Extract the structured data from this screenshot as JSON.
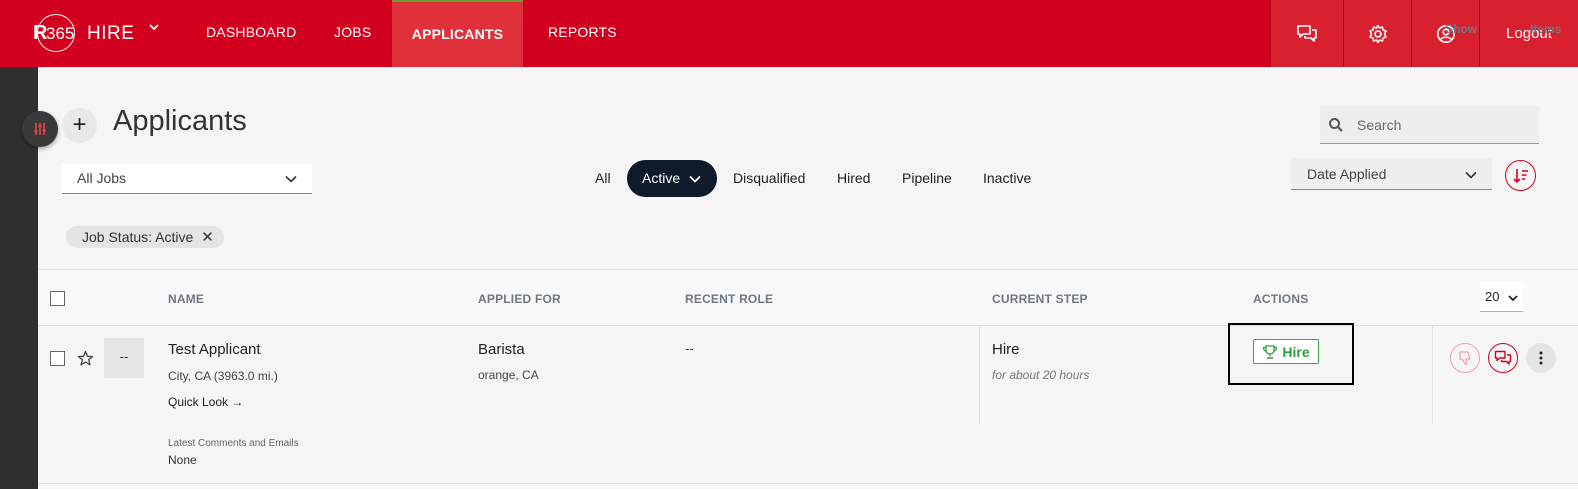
{
  "brand": {
    "logo_r": "R",
    "logo_365": "365",
    "logo_hire": "HIRE",
    "accent": "#d2001e"
  },
  "nav": {
    "items": [
      {
        "label": "DASHBOARD"
      },
      {
        "label": "JOBS"
      },
      {
        "label": "APPLICANTS"
      },
      {
        "label": "REPORTS"
      }
    ],
    "active": "APPLICANTS",
    "logout": "Logout",
    "icons": [
      "chat-icon",
      "gear-icon",
      "user-icon"
    ]
  },
  "page": {
    "title": "Applicants",
    "add_label": "+",
    "search_placeholder": "Search"
  },
  "filters": {
    "jobs_select": "All Jobs",
    "tabs": [
      "All",
      "Active",
      "Disqualified",
      "Hired",
      "Pipeline",
      "Inactive"
    ],
    "active_tab": "Active",
    "sort_by": "Date Applied",
    "chip": "Job Status: Active",
    "chip_close": "✕"
  },
  "table": {
    "headers": [
      "NAME",
      "APPLIED FOR",
      "RECENT ROLE",
      "CURRENT STEP",
      "ACTIONS"
    ],
    "show_label": "Show",
    "page_size": "20",
    "items_label": "Items",
    "rows": [
      {
        "avatar": "--",
        "name": "Test Applicant",
        "location": "City, CA (3963.0 mi.)",
        "quick_look": "Quick Look →",
        "applied_for": "Barista",
        "applied_location": "orange, CA",
        "recent_role": "--",
        "current_step": "Hire",
        "step_time": "for about 20 hours",
        "action": "Hire",
        "latest_label": "Latest Comments and Emails",
        "latest_value": "None"
      }
    ]
  }
}
